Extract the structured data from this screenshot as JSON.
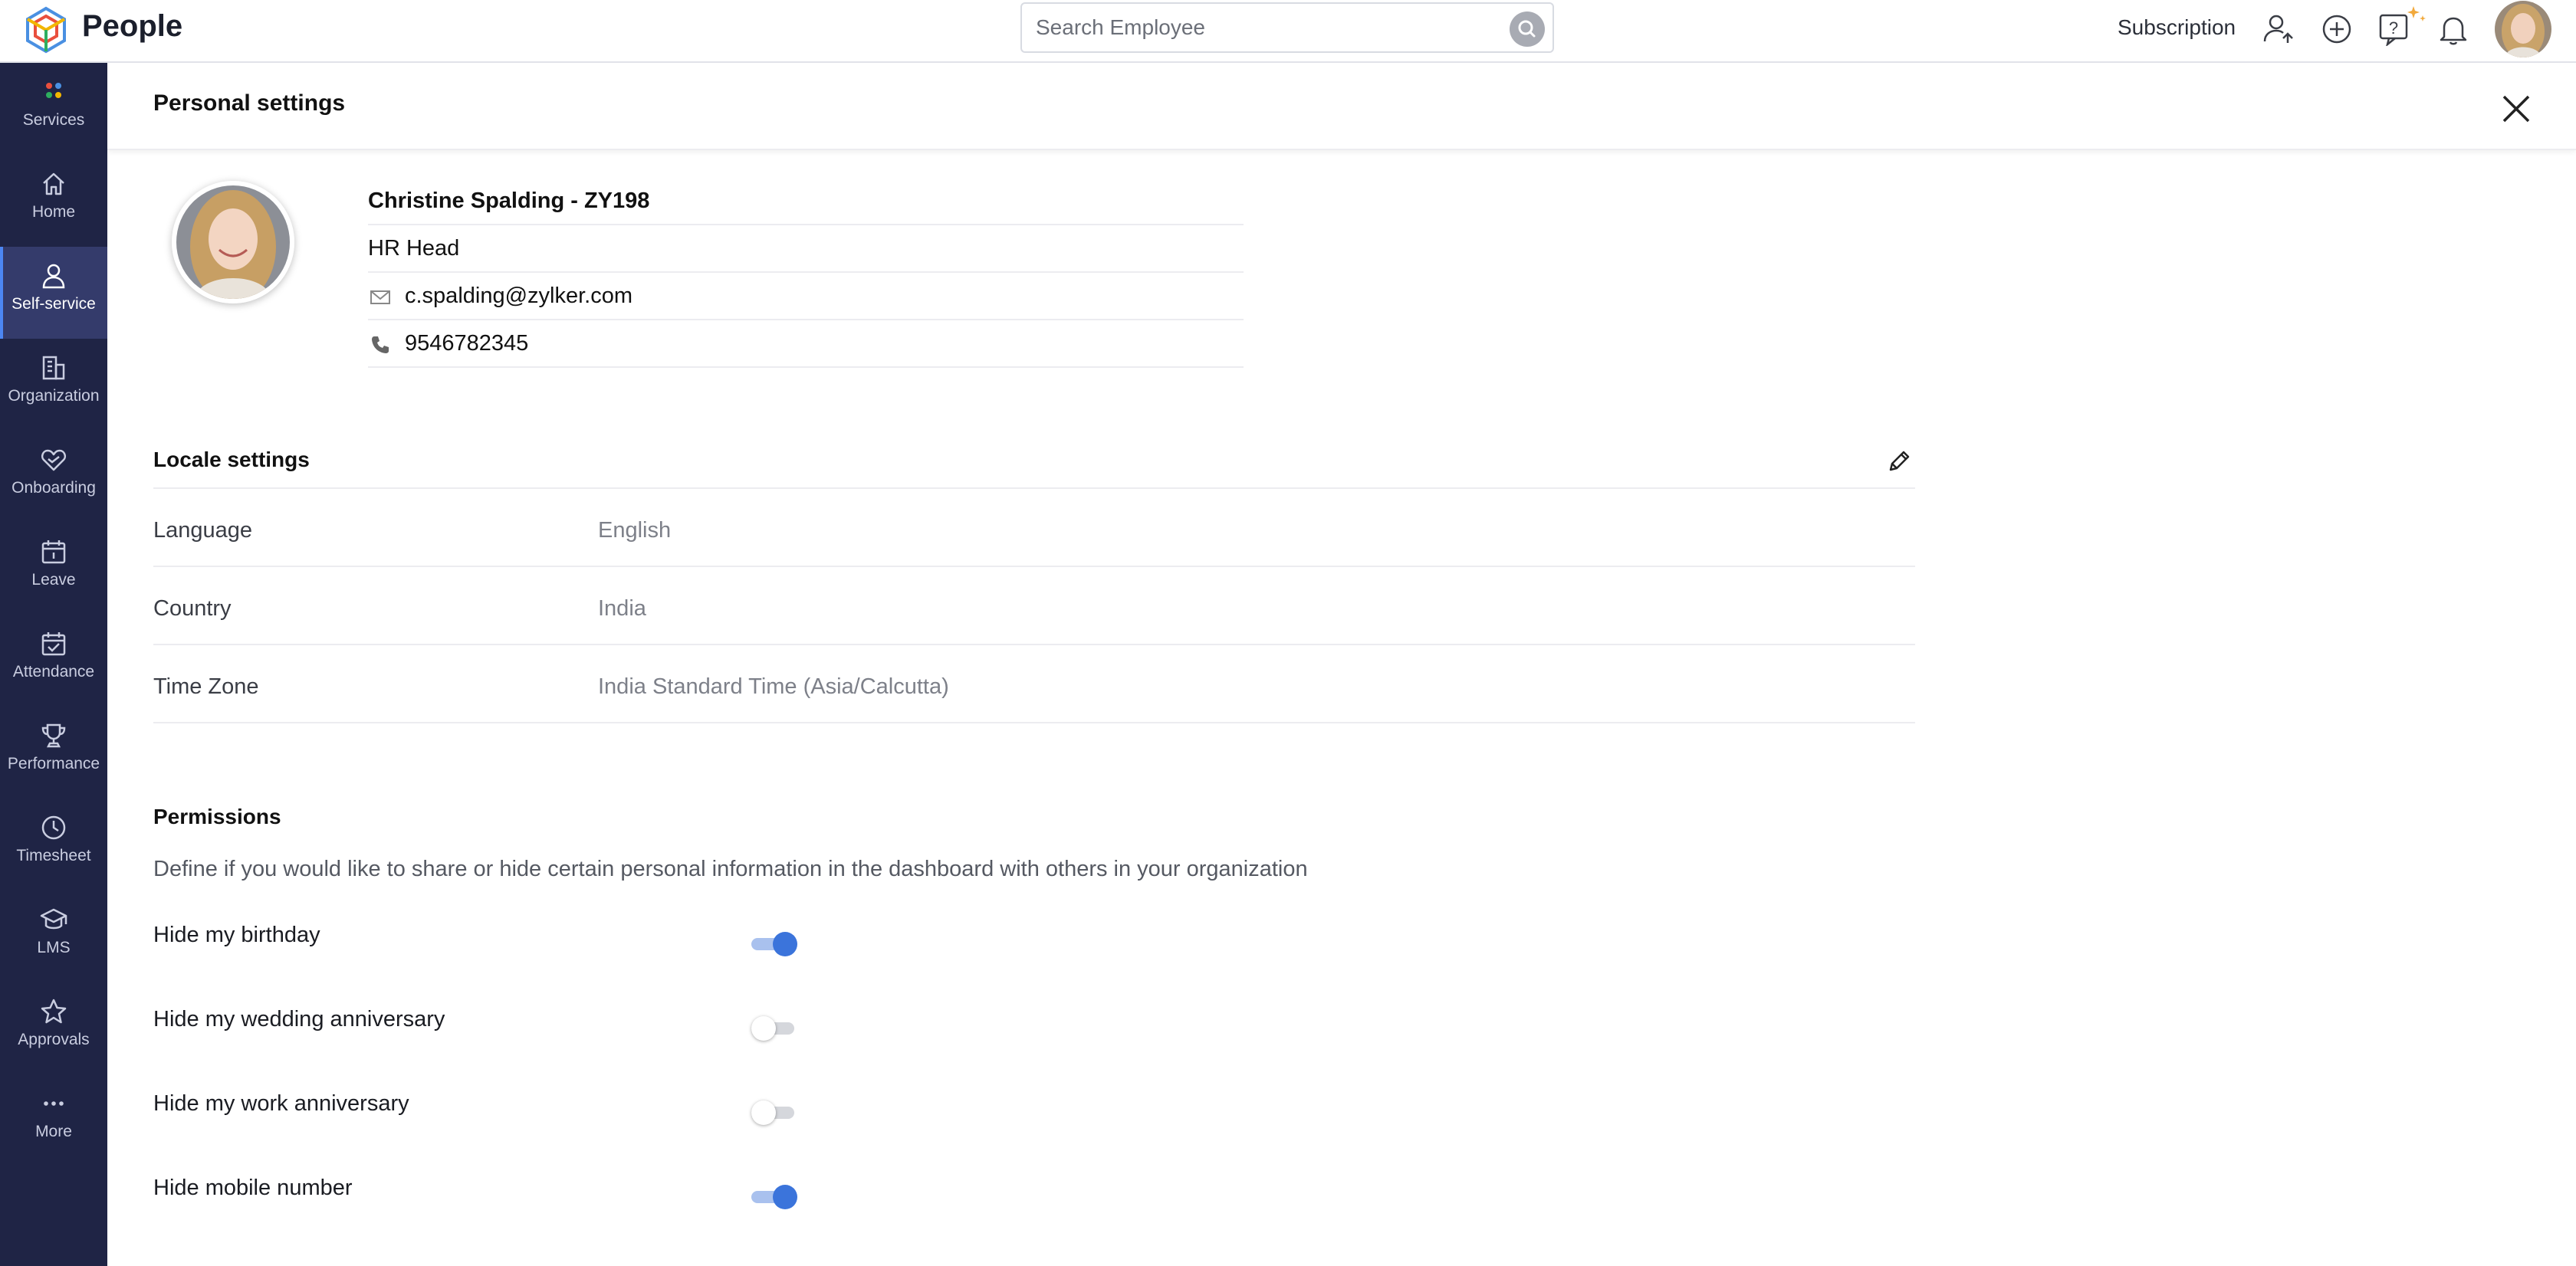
{
  "app": {
    "name": "People"
  },
  "search": {
    "placeholder": "Search Employee"
  },
  "topbar": {
    "subscription_label": "Subscription"
  },
  "colors": {
    "sidebar_bg": "#1f2445",
    "sidebar_active": "#343b6b",
    "accent": "#3b74db"
  },
  "sidebar": {
    "items": [
      {
        "label": "Services",
        "icon": "services-icon"
      },
      {
        "label": "Home",
        "icon": "home-icon"
      },
      {
        "label": "Self-service",
        "icon": "person-icon",
        "active": true
      },
      {
        "label": "Organization",
        "icon": "building-icon"
      },
      {
        "label": "Onboarding",
        "icon": "handshake-icon"
      },
      {
        "label": "Leave",
        "icon": "calendar-icon"
      },
      {
        "label": "Attendance",
        "icon": "calendar-check-icon"
      },
      {
        "label": "Performance",
        "icon": "trophy-icon"
      },
      {
        "label": "Timesheet",
        "icon": "clock-icon"
      },
      {
        "label": "LMS",
        "icon": "graduation-cap-icon"
      },
      {
        "label": "Approvals",
        "icon": "star-icon"
      },
      {
        "label": "More",
        "icon": "more-icon"
      }
    ]
  },
  "page": {
    "title": "Personal settings"
  },
  "profile": {
    "name": "Christine Spalding - ZY198",
    "role": "HR Head",
    "email": "c.spalding@zylker.com",
    "phone": "9546782345"
  },
  "locale": {
    "title": "Locale settings",
    "rows": [
      {
        "label": "Language",
        "value": "English"
      },
      {
        "label": "Country",
        "value": "India"
      },
      {
        "label": "Time Zone",
        "value": "India Standard Time (Asia/Calcutta)"
      }
    ]
  },
  "permissions": {
    "title": "Permissions",
    "description": "Define if you would like to share or hide certain personal information in the dashboard with others in your organization",
    "items": [
      {
        "label": "Hide my birthday",
        "enabled": true
      },
      {
        "label": "Hide my wedding anniversary",
        "enabled": false
      },
      {
        "label": "Hide my work anniversary",
        "enabled": false
      },
      {
        "label": "Hide mobile number",
        "enabled": true
      }
    ]
  }
}
